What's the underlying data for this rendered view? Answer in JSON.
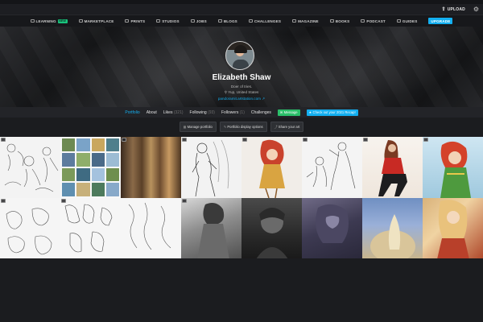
{
  "util": {
    "upload_label": "UPLOAD"
  },
  "nav": {
    "items": [
      {
        "label": "LEARNING",
        "badge": "NEW"
      },
      {
        "label": "MARKETPLACE"
      },
      {
        "label": "PRINTS"
      },
      {
        "label": "STUDIOS"
      },
      {
        "label": "JOBS"
      },
      {
        "label": "BLOGS"
      },
      {
        "label": "CHALLENGES"
      },
      {
        "label": "MAGAZINE"
      },
      {
        "label": "BOOKS"
      },
      {
        "label": "PODCAST"
      },
      {
        "label": "GUIDES"
      }
    ],
    "upgrade_label": "UPGRADE"
  },
  "profile": {
    "name": "Elizabeth Shaw",
    "tagline": "Doer of tries.",
    "location": "Yup, United States",
    "website": "pandoramit.artstation.com"
  },
  "tabs": {
    "portfolio": "Portfolio",
    "about": "About",
    "likes": "Likes",
    "likes_count": "(321)",
    "following": "Following",
    "following_count": "(93)",
    "followers": "Followers",
    "followers_count": "(1)",
    "challenges": "Challenges",
    "message": "Message",
    "recap": "Check out your 2021 Recap!"
  },
  "actions": {
    "manage": "Manage portfolio",
    "display": "Portfolio display options",
    "share": "Share your art"
  },
  "colors": {
    "accent": "#13aff0",
    "green": "#19c37d",
    "bg": "#1b1c1f"
  }
}
